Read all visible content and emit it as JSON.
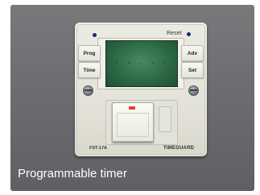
{
  "caption": "Programmable timer",
  "device": {
    "reset_label": "Reset",
    "lcd_readout": "- - . - -",
    "buttons": {
      "prog": "Prog",
      "time": "Time",
      "adv": "Adv",
      "set": "Set"
    },
    "model_label": "FST-17A",
    "brand_label": "TIMEGUARD"
  },
  "colors": {
    "background_panel": "#6d6e71",
    "lcd_green": "#2b6643",
    "plate_ivory": "#e4e3d9",
    "indicator_red": "#e2412e",
    "caption_text": "#ffffff"
  }
}
